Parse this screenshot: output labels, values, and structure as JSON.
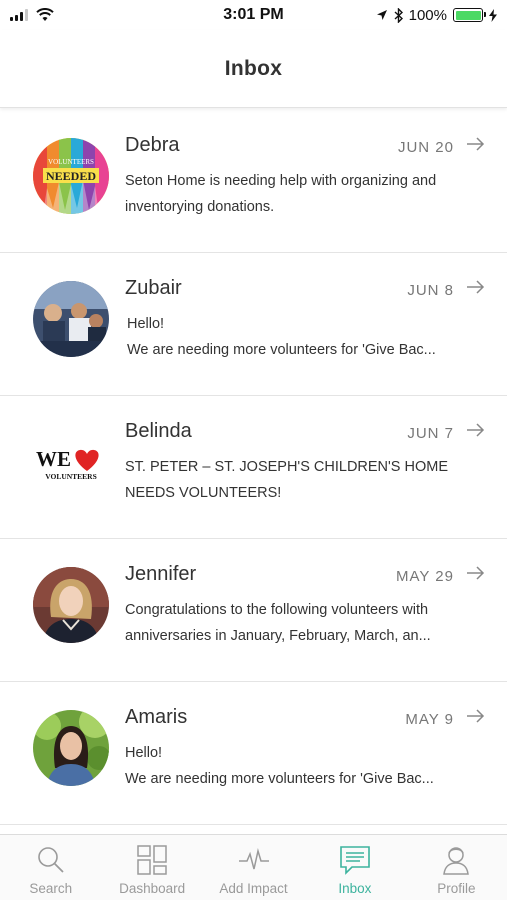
{
  "status_bar": {
    "time": "3:01 PM",
    "battery": "100%",
    "battery_level": 1.0
  },
  "header": {
    "title": "Inbox"
  },
  "messages": [
    {
      "sender": "Debra",
      "date": "JUN 20",
      "line1": "Seton Home is needing help with organizing and",
      "line2": "inventorying donations.",
      "avatar_text_top": "VOLUNTEERS",
      "avatar_text_main": "NEEDED"
    },
    {
      "sender": "Zubair",
      "date": "JUN 8",
      "line1": "Hello!",
      "line2": "We are needing more volunteers for 'Give Bac..."
    },
    {
      "sender": "Belinda",
      "date": "JUN 7",
      "line1": "ST. PETER – ST. JOSEPH'S CHILDREN'S HOME",
      "line2": "NEEDS VOLUNTEERS!",
      "avatar_text_top": "WE",
      "avatar_text_main": "VOLUNTEERS"
    },
    {
      "sender": "Jennifer",
      "date": "MAY 29",
      "line1": "Congratulations to the following volunteers with",
      "line2": "anniversaries in January, February, March, an..."
    },
    {
      "sender": "Amaris",
      "date": "MAY 9",
      "line1": "Hello!",
      "line2": "We are needing more volunteers for 'Give Bac..."
    }
  ],
  "tabs": [
    {
      "label": "Search",
      "icon": "search-icon"
    },
    {
      "label": "Dashboard",
      "icon": "dashboard-icon"
    },
    {
      "label": "Add Impact",
      "icon": "pulse-icon"
    },
    {
      "label": "Inbox",
      "icon": "inbox-icon",
      "active": true
    },
    {
      "label": "Profile",
      "icon": "profile-icon"
    }
  ],
  "colors": {
    "accent": "#3db39e",
    "battery": "#4cd964"
  }
}
